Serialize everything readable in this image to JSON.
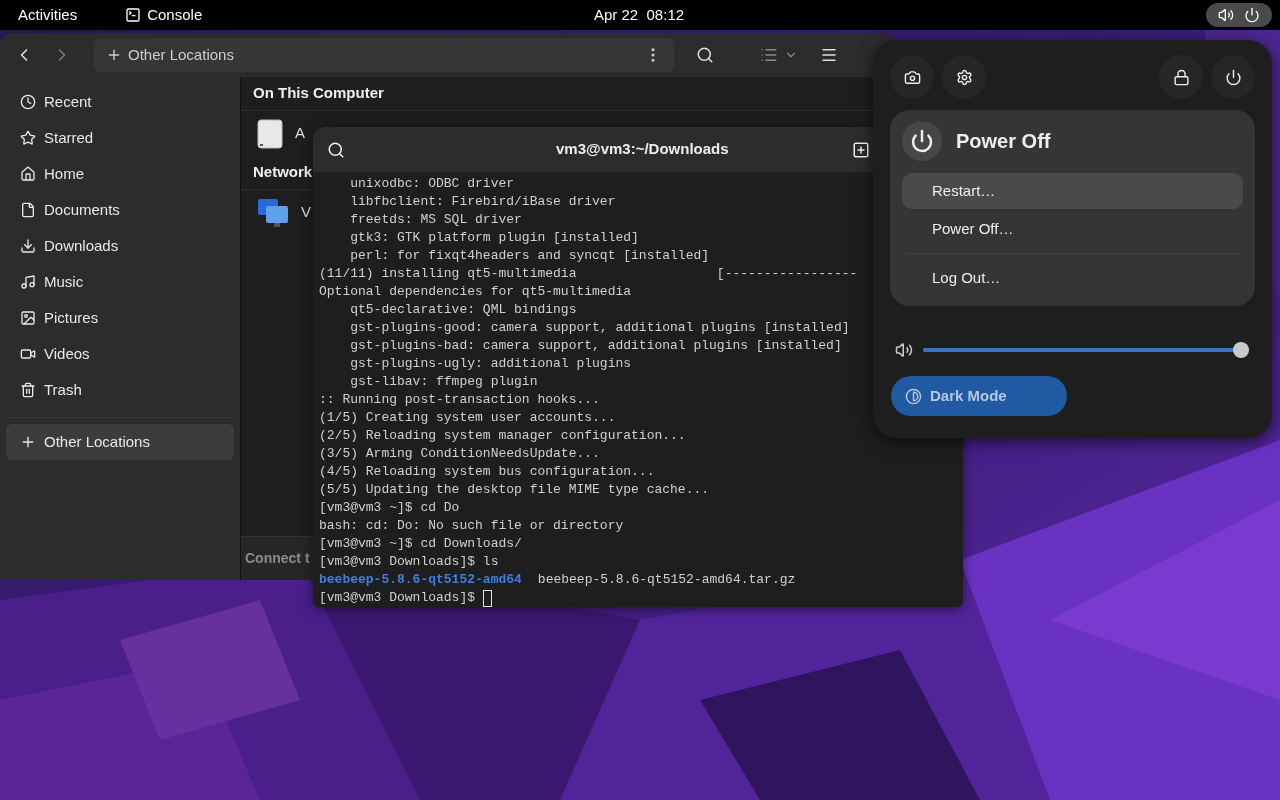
{
  "top_bar": {
    "activities": "Activities",
    "app": "Console",
    "clock": "Apr 22  08:12",
    "status_pill": {
      "selected": true
    }
  },
  "files_window": {
    "path": "Other Locations",
    "sidebar": {
      "items": [
        {
          "kind": "recent",
          "label": "Recent",
          "selected": false
        },
        {
          "kind": "starred",
          "label": "Starred",
          "selected": false
        },
        {
          "kind": "home",
          "label": "Home",
          "selected": false
        },
        {
          "kind": "documents",
          "label": "Documents",
          "selected": false
        },
        {
          "kind": "downloads",
          "label": "Downloads",
          "selected": false
        },
        {
          "kind": "music",
          "label": "Music",
          "selected": false
        },
        {
          "kind": "pictures",
          "label": "Pictures",
          "selected": false
        },
        {
          "kind": "videos",
          "label": "Videos",
          "selected": false
        },
        {
          "kind": "trash",
          "label": "Trash",
          "selected": false
        }
      ],
      "other": {
        "kind": "other",
        "label": "Other Locations",
        "selected": true
      }
    },
    "sections": [
      {
        "title": "On This Computer",
        "rows": [
          {
            "kind": "disk",
            "label": "A"
          }
        ]
      },
      {
        "title": "Network",
        "rows": [
          {
            "kind": "network",
            "label": "V"
          }
        ]
      }
    ],
    "connect_bar": "Connect t"
  },
  "terminal": {
    "title": "vm3@vm3:~/Downloads",
    "lines": [
      {
        "kind": "plain",
        "text": "    unixodbc: ODBC driver"
      },
      {
        "kind": "plain",
        "text": "    libfbclient: Firebird/iBase driver"
      },
      {
        "kind": "plain",
        "text": "    freetds: MS SQL driver"
      },
      {
        "kind": "plain",
        "text": "    gtk3: GTK platform plugin [installed]"
      },
      {
        "kind": "plain",
        "text": "    perl: for fixqt4headers and syncqt [installed]"
      },
      {
        "kind": "plain",
        "text": "(11/11) installing qt5-multimedia                  [-----------------"
      },
      {
        "kind": "plain",
        "text": "Optional dependencies for qt5-multimedia"
      },
      {
        "kind": "plain",
        "text": "    qt5-declarative: QML bindings"
      },
      {
        "kind": "plain",
        "text": "    gst-plugins-good: camera support, additional plugins [installed]"
      },
      {
        "kind": "plain",
        "text": "    gst-plugins-bad: camera support, additional plugins [installed]"
      },
      {
        "kind": "plain",
        "text": "    gst-plugins-ugly: additional plugins"
      },
      {
        "kind": "plain",
        "text": "    gst-libav: ffmpeg plugin"
      },
      {
        "kind": "plain",
        "text": ":: Running post-transaction hooks..."
      },
      {
        "kind": "plain",
        "text": "(1/5) Creating system user accounts..."
      },
      {
        "kind": "plain",
        "text": "(2/5) Reloading system manager configuration..."
      },
      {
        "kind": "plain",
        "text": "(3/5) Arming ConditionNeedsUpdate..."
      },
      {
        "kind": "plain",
        "text": "(4/5) Reloading system bus configuration..."
      },
      {
        "kind": "plain",
        "text": "(5/5) Updating the desktop file MIME type cache..."
      },
      {
        "kind": "plain",
        "text": "[vm3@vm3 ~]$ cd Do"
      },
      {
        "kind": "plain",
        "text": "bash: cd: Do: No such file or directory"
      },
      {
        "kind": "plain",
        "text": "[vm3@vm3 ~]$ cd Downloads/"
      },
      {
        "kind": "plain",
        "text": "[vm3@vm3 Downloads]$ ls"
      },
      {
        "kind": "listing",
        "items": [
          {
            "kind": "directory",
            "text": "beebeep-5.8.6-qt5152-amd64"
          },
          {
            "kind": "file",
            "text": "beebeep-5.8.6-qt5152-amd64.tar.gz"
          }
        ]
      },
      {
        "kind": "prompt",
        "text": "[vm3@vm3 Downloads]$ ",
        "cursor": true
      }
    ]
  },
  "system_menu": {
    "power_menu": {
      "title": "Power Off",
      "expanded": true,
      "groups": [
        [
          {
            "label": "Restart…",
            "selected": true
          },
          {
            "label": "Power Off…",
            "selected": false
          }
        ],
        [
          {
            "label": "Log Out…",
            "selected": false
          }
        ]
      ]
    },
    "volume": {
      "level": 1
    },
    "dark_mode": {
      "label": "Dark Mode",
      "on": true
    }
  }
}
